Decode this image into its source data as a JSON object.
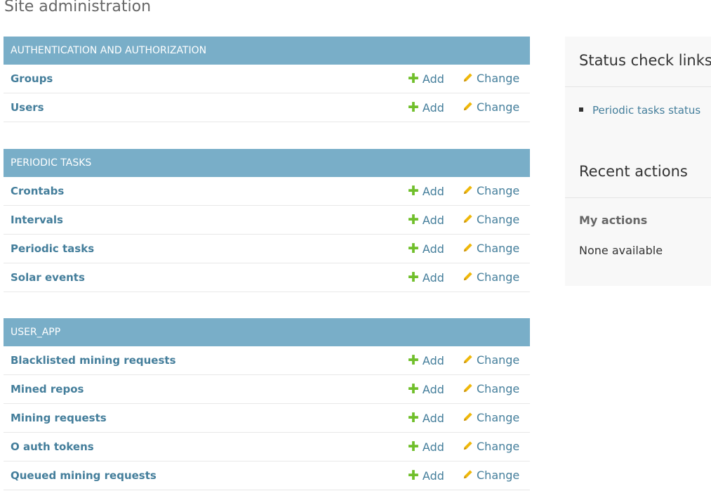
{
  "page": {
    "title": "Site administration"
  },
  "modules": [
    {
      "caption": "AUTHENTICATION AND AUTHORIZATION",
      "models": [
        {
          "name": "Groups",
          "add": "Add",
          "change": "Change"
        },
        {
          "name": "Users",
          "add": "Add",
          "change": "Change"
        }
      ]
    },
    {
      "caption": "PERIODIC TASKS",
      "models": [
        {
          "name": "Crontabs",
          "add": "Add",
          "change": "Change"
        },
        {
          "name": "Intervals",
          "add": "Add",
          "change": "Change"
        },
        {
          "name": "Periodic tasks",
          "add": "Add",
          "change": "Change"
        },
        {
          "name": "Solar events",
          "add": "Add",
          "change": "Change"
        }
      ]
    },
    {
      "caption": "USER_APP",
      "models": [
        {
          "name": "Blacklisted mining requests",
          "add": "Add",
          "change": "Change"
        },
        {
          "name": "Mined repos",
          "add": "Add",
          "change": "Change"
        },
        {
          "name": "Mining requests",
          "add": "Add",
          "change": "Change"
        },
        {
          "name": "O auth tokens",
          "add": "Add",
          "change": "Change"
        },
        {
          "name": "Queued mining requests",
          "add": "Add",
          "change": "Change"
        }
      ]
    }
  ],
  "sidebar": {
    "status_title": "Status check links",
    "status_links": [
      "Periodic tasks status"
    ],
    "recent_title": "Recent actions",
    "my_actions_title": "My actions",
    "none_available": "None available"
  },
  "icons": {
    "add": "plus-icon",
    "change": "pencil-icon"
  },
  "colors": {
    "caption_bg": "#79aec8",
    "link": "#447e9b",
    "add_icon": "#70bf2b",
    "change_icon": "#efb80b"
  }
}
